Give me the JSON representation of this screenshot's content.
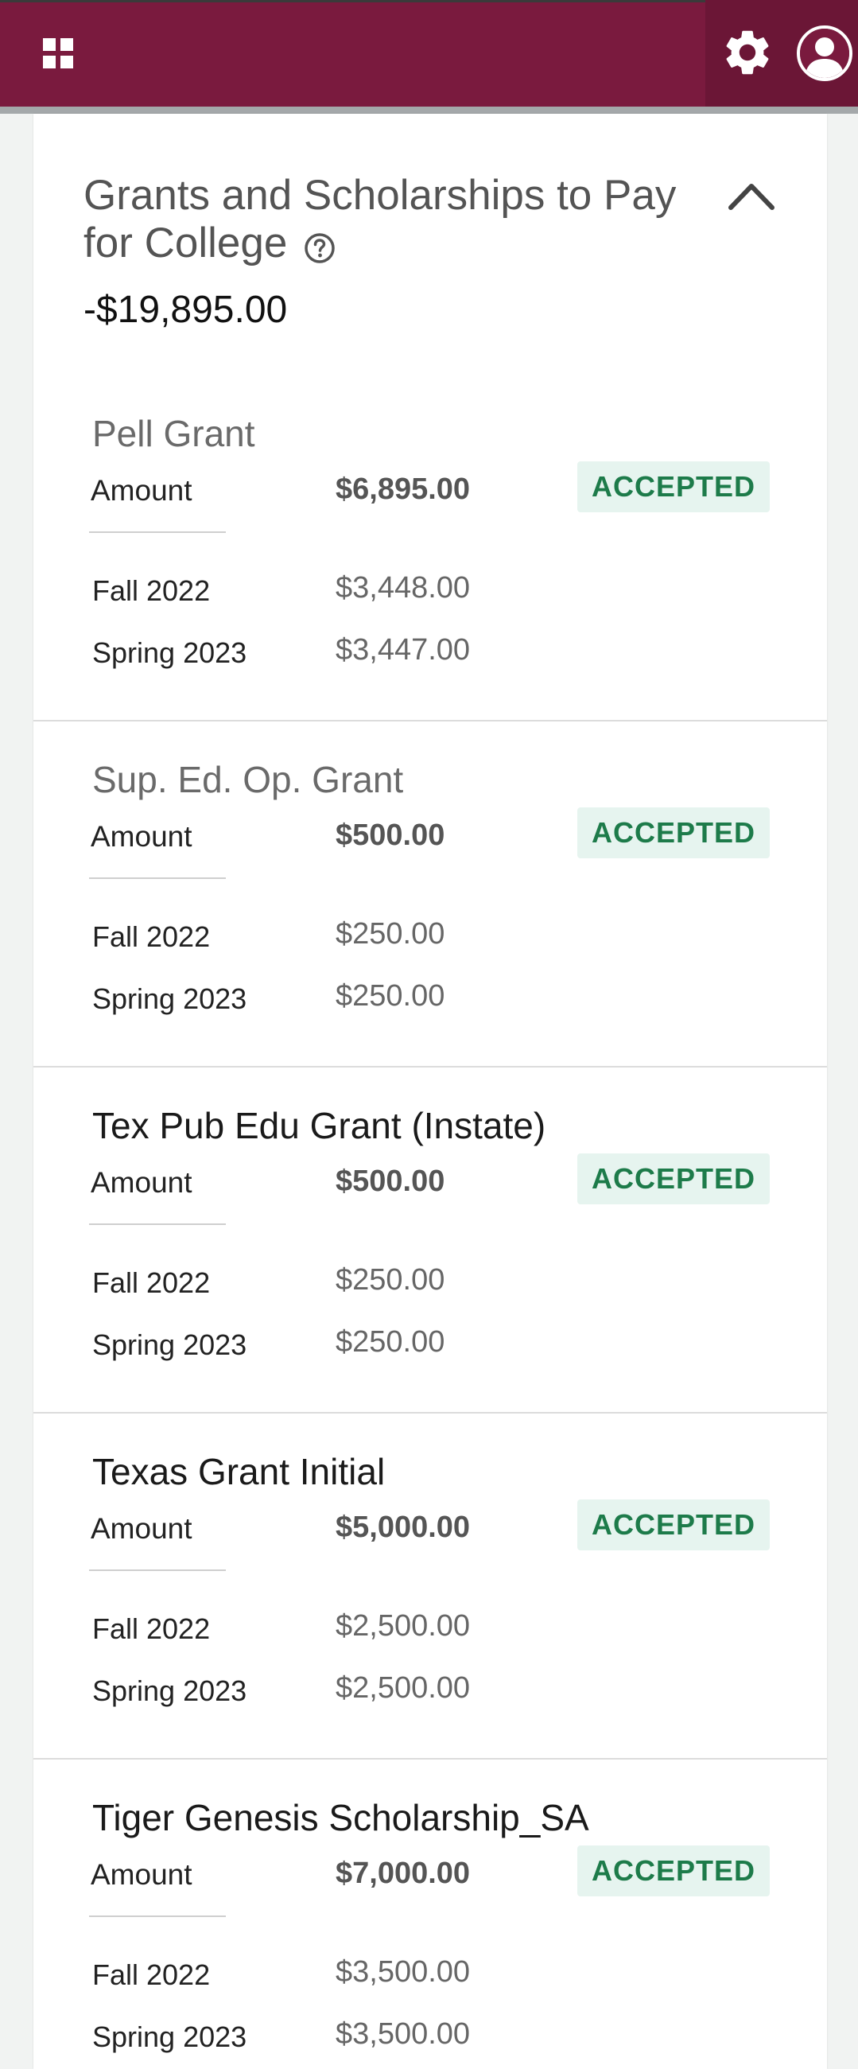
{
  "header": {
    "apps_icon": "grid-apps-icon",
    "settings_icon": "gear-icon",
    "user_icon": "user-avatar-icon"
  },
  "section": {
    "title": "Grants and Scholarships to Pay for College",
    "help_icon": "question-circle-icon",
    "collapse_icon": "chevron-up-icon",
    "total": "-$19,895.00"
  },
  "awards": [
    {
      "name": "Pell Grant",
      "amount_label": "Amount",
      "amount": "$6,895.00",
      "status": "ACCEPTED",
      "terms": [
        {
          "label": "Fall 2022",
          "value": "$3,448.00"
        },
        {
          "label": "Spring 2023",
          "value": "$3,447.00"
        }
      ]
    },
    {
      "name": "Sup. Ed. Op. Grant",
      "amount_label": "Amount",
      "amount": "$500.00",
      "status": "ACCEPTED",
      "terms": [
        {
          "label": "Fall 2022",
          "value": "$250.00"
        },
        {
          "label": "Spring 2023",
          "value": "$250.00"
        }
      ]
    },
    {
      "name": "Tex Pub Edu Grant (Instate)",
      "amount_label": "Amount",
      "amount": "$500.00",
      "status": "ACCEPTED",
      "terms": [
        {
          "label": "Fall 2022",
          "value": "$250.00"
        },
        {
          "label": "Spring 2023",
          "value": "$250.00"
        }
      ]
    },
    {
      "name": "Texas Grant Initial",
      "amount_label": "Amount",
      "amount": "$5,000.00",
      "status": "ACCEPTED",
      "terms": [
        {
          "label": "Fall 2022",
          "value": "$2,500.00"
        },
        {
          "label": "Spring 2023",
          "value": "$2,500.00"
        }
      ]
    },
    {
      "name": "Tiger Genesis Scholarship_SA",
      "amount_label": "Amount",
      "amount": "$7,000.00",
      "status": "ACCEPTED",
      "terms": [
        {
          "label": "Fall 2022",
          "value": "$3,500.00"
        },
        {
          "label": "Spring 2023",
          "value": "$3,500.00"
        }
      ]
    }
  ],
  "colors": {
    "brand": "#7a1a3e",
    "accepted_bg": "#e6f4ef",
    "accepted_text": "#1d7b4a"
  }
}
